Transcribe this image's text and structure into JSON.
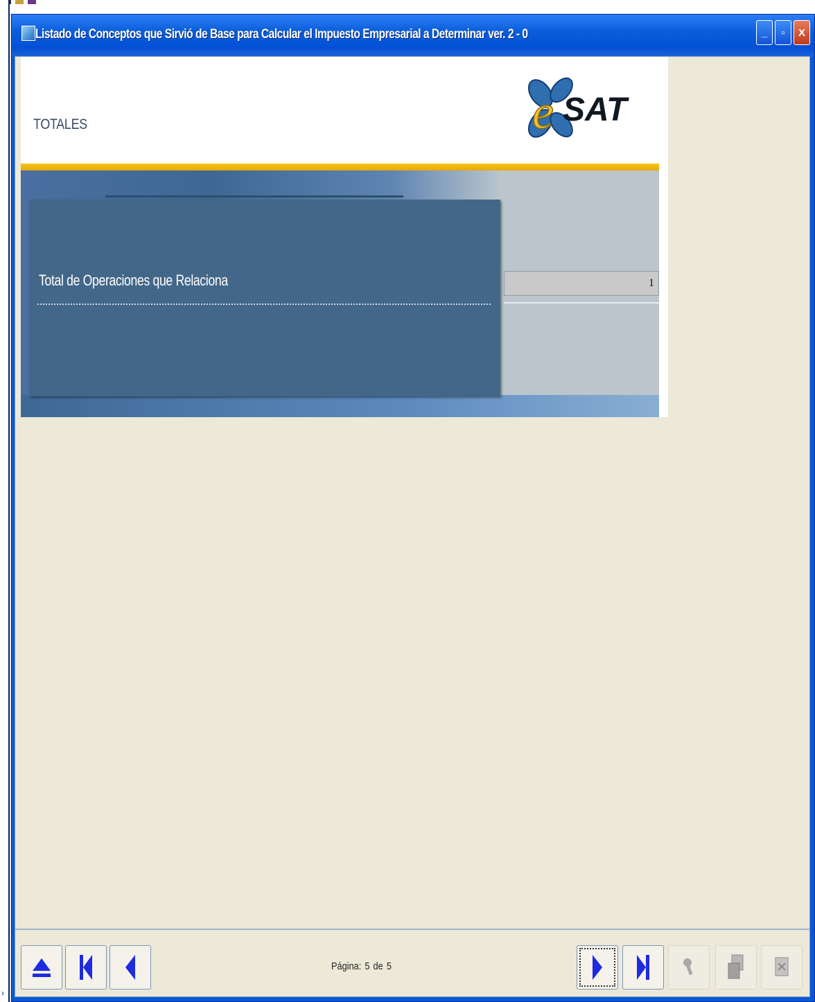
{
  "window": {
    "title": "Listado de Conceptos que Sirvió de Base para Calcular el Impuesto Empresarial a Determinar ver. 2 - 0",
    "minimize_glyph": "_",
    "maximize_glyph": "▫",
    "close_glyph": "X"
  },
  "report": {
    "section_title": "TOTALES",
    "logo_letter": "e",
    "logo_text": "SAT",
    "fields": [
      {
        "label": "Total de Operaciones que Relaciona",
        "value": "1"
      }
    ]
  },
  "nav": {
    "page_label": "Página:",
    "current_page": "5",
    "of_label": "de",
    "total_pages": "5",
    "buttons": [
      {
        "name": "up-button",
        "icon": "eject-up-icon"
      },
      {
        "name": "first-page-button",
        "icon": "first-page-icon"
      },
      {
        "name": "prev-page-button",
        "icon": "prev-page-icon"
      },
      {
        "name": "next-page-button",
        "icon": "next-page-icon"
      },
      {
        "name": "last-page-button",
        "icon": "last-page-icon"
      },
      {
        "name": "search-button",
        "icon": "search-icon",
        "disabled": true
      },
      {
        "name": "copy-button",
        "icon": "copy-icon",
        "disabled": true
      },
      {
        "name": "export-button",
        "icon": "export-icon",
        "disabled": true
      }
    ]
  },
  "colors": {
    "title_bar": "#0A58D9",
    "card": "#436788",
    "accent_gold": "#F5C518",
    "nav_arrow": "#1E2BE0"
  }
}
